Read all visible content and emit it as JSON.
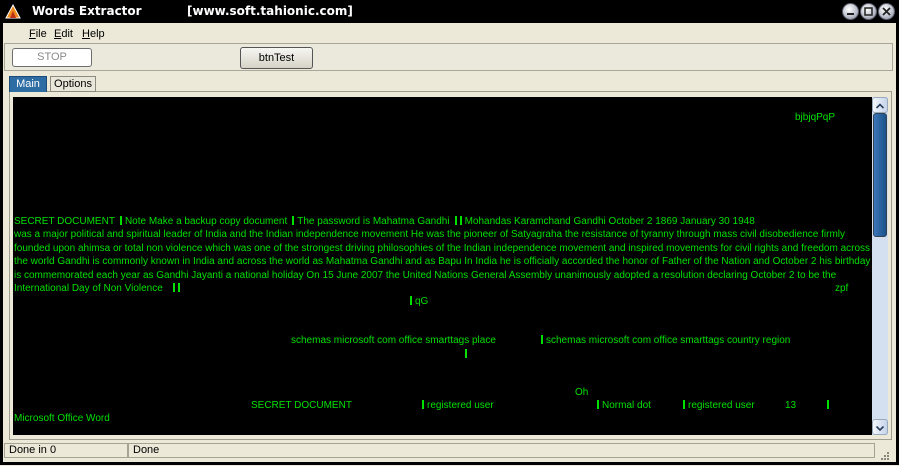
{
  "window": {
    "title": "Words Extractor",
    "url_title": "[www.soft.tahionic.com]",
    "buttons": [
      "minimize-button",
      "maximize-button",
      "close-button"
    ]
  },
  "menu": {
    "items": [
      {
        "label": "File",
        "accel": "F",
        "rest": "ile"
      },
      {
        "label": "Edit",
        "accel": "E",
        "rest": "dit"
      },
      {
        "label": "Help",
        "accel": "H",
        "rest": "elp"
      }
    ]
  },
  "toolbar": {
    "stop_label": "STOP",
    "test_label": "btnTest"
  },
  "tabs": [
    {
      "label": "Main",
      "active": true
    },
    {
      "label": "Options",
      "active": false
    }
  ],
  "output": {
    "text_color": "#00e000",
    "background": "#000000",
    "top_right": "bjbjqPqP",
    "doc_line_parts": [
      "SECRET DOCUMENT",
      "Note   Make a backup copy document",
      "The password is    Mahatma Gandhi",
      "",
      "Mohandas Karamchand Gandhi   October 2  1869   January 30  1948"
    ],
    "paragraph": "was a major political and spiritual leader of India and the Indian independence movement  He was the pioneer of Satyagraha the resistance of tyranny through mass civil disobedience firmly founded upon ahimsa or total non violence which was one of the strongest driving philosophies of the Indian independence movement and inspired movements for civil rights and freedom across the world  Gandhi is commonly known in India and across the world as Mahatma Gandhi and as Bapu  In India  he is officially accorded the honor of Father of the Nation and October 2 his birthday  is commemorated each year as Gandhi Jayanti a national holiday  On 15 June 2007  the United Nations General Assembly unanimously adopted a resolution declaring October 2 to be the International Day of Non Violence",
    "zpf": "zpf",
    "qg": "qG",
    "schemas_place": "schemas microsoft com office smarttags  place",
    "schemas_country": "schemas microsoft com office smarttags  country region",
    "oh": "Oh",
    "secret_doc_2": "SECRET DOCUMENT",
    "registered_user_1": "registered user",
    "normal_dot": "Normal dot",
    "registered_user_2": "registered user",
    "number": "13",
    "app_name": "Microsoft Office Word"
  },
  "status": {
    "left": "Done in 0",
    "right": "Done"
  }
}
